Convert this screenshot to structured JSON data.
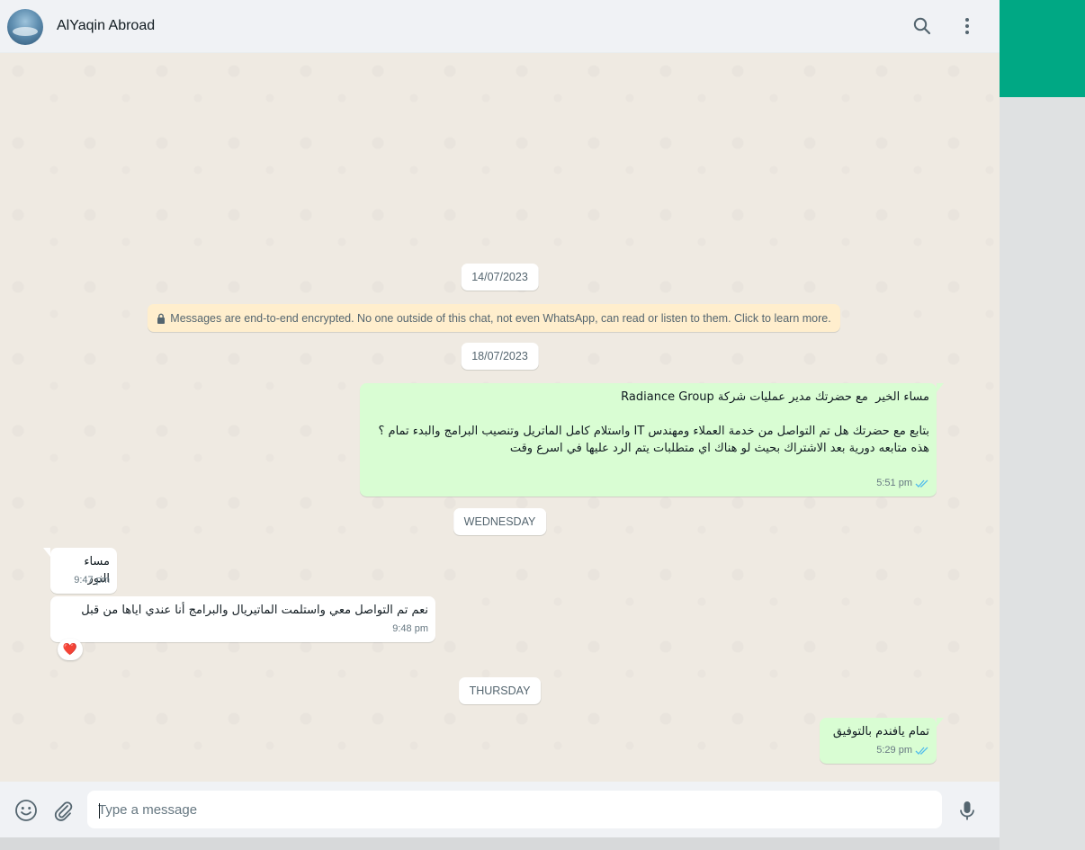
{
  "header": {
    "contact_name": "AlYaqin Abroad",
    "icons": [
      "search-icon",
      "menu-icon"
    ]
  },
  "chat": {
    "date_chips": [
      "14/07/2023",
      "18/07/2023",
      "WEDNESDAY",
      "THURSDAY"
    ],
    "encryption_notice": "Messages are end-to-end encrypted. No one outside of this chat, not even WhatsApp, can read or listen to them. Click to learn more.",
    "messages": [
      {
        "direction": "out",
        "text": "مساء الخير  مع حضرتك مدير عمليات شركة Radiance Group\n\nبتابع مع حضرتك هل تم التواصل من خدمة العملاء ومهندس IT واستلام كامل الماتريل وتنصيب البرامج والبدء تمام ؟\nهذه متابعه دورية بعد الاشتراك بحيث لو هناك اي متطلبات يتم الرد عليها في اسرع وقت",
        "time": "5:51 pm",
        "status": "read"
      },
      {
        "direction": "in",
        "text": "مساء النور",
        "time": "9:47 pm"
      },
      {
        "direction": "in",
        "text": "نعم تم التواصل معي واستلمت الماتيريال والبرامج أنا عندي اياها من قبل",
        "time": "9:48 pm",
        "reaction": "❤️"
      },
      {
        "direction": "out",
        "text": "تمام يافندم بالتوفيق",
        "time": "5:29 pm",
        "status": "read"
      }
    ]
  },
  "footer": {
    "placeholder": "Type a message",
    "icons": [
      "emoji-icon",
      "attach-icon",
      "mic-icon"
    ]
  },
  "colors": {
    "accent": "#00a884",
    "outgoing_bubble": "#d9fdd3",
    "incoming_bubble": "#ffffff",
    "chat_bg": "#efeae2",
    "read_ticks": "#53bdeb"
  }
}
